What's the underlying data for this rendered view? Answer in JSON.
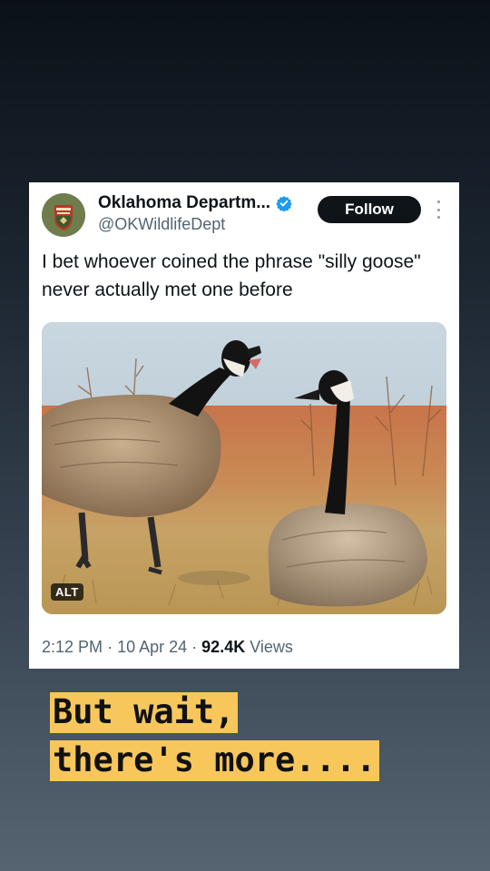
{
  "tweet": {
    "display_name": "Oklahoma Departm...",
    "handle": "@OKWildlifeDept",
    "follow_label": "Follow",
    "text": "I bet whoever coined the phrase \"silly goose\" never actually met one before",
    "media_alt_badge": "ALT",
    "time": "2:12 PM",
    "date": "10 Apr 24",
    "views_count": "92.4K",
    "views_label": "Views",
    "separator": "·"
  },
  "caption": {
    "line1": "But wait,",
    "line2": "there's more...."
  },
  "icons": {
    "verified": "verified-badge-icon",
    "more": "more-options-icon",
    "avatar": "agency-logo-avatar"
  },
  "colors": {
    "verified_blue": "#1d9bf0",
    "follow_button": "#0f1419",
    "caption_highlight": "#f7c75c",
    "muted_text": "#536471"
  }
}
